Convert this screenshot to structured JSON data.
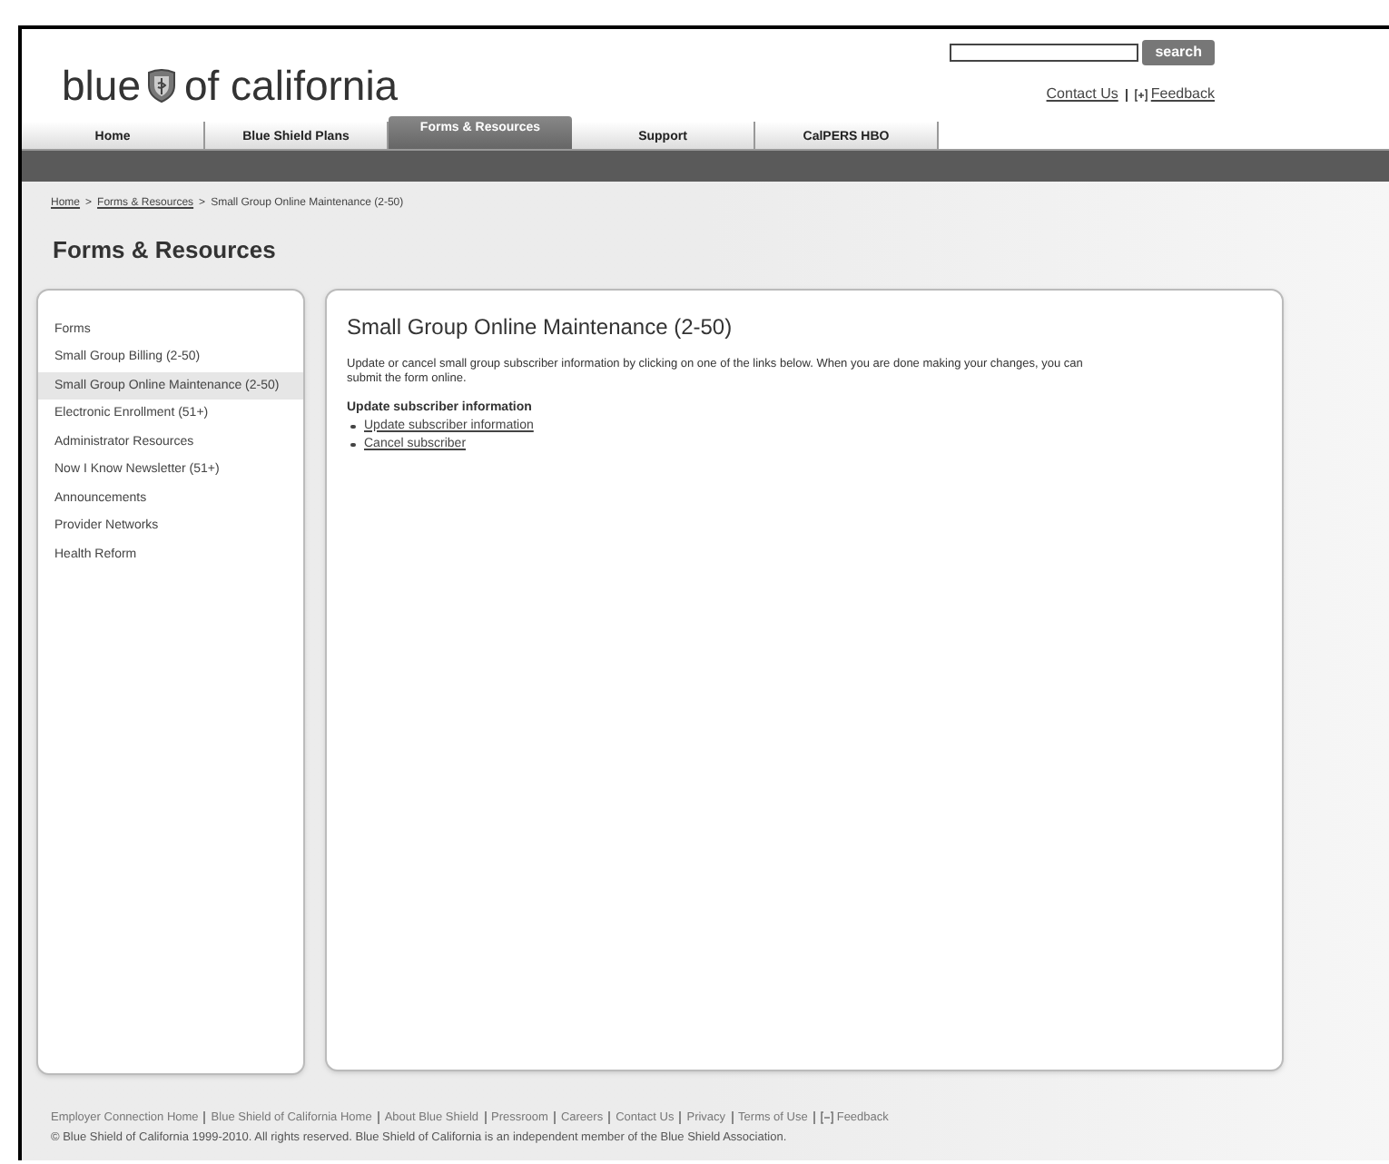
{
  "logo": {
    "before": "blue",
    "after": "of california"
  },
  "search": {
    "button": "search"
  },
  "header_links": [
    {
      "label": "Contact Us",
      "kind": "plain"
    },
    {
      "label": "Feedback",
      "kind": "plus"
    }
  ],
  "tabs": [
    {
      "label": "Home",
      "selected": false
    },
    {
      "label": "Blue Shield Plans",
      "selected": false
    },
    {
      "label": "Forms & Resources",
      "selected": true
    },
    {
      "label": "Support",
      "selected": false
    },
    {
      "label": "CalPERS HBO",
      "selected": false
    }
  ],
  "breadcrumb_separator": ">",
  "breadcrumb": [
    {
      "label": "Home",
      "link": true
    },
    {
      "label": "Forms & Resources",
      "link": true
    },
    {
      "label": "Small Group Online Maintenance (2-50)",
      "link": false
    }
  ],
  "page_title": "Forms & Resources",
  "sidebar": {
    "items": [
      {
        "label": "Forms",
        "selected": false
      },
      {
        "label": "Small Group Billing (2-50)",
        "selected": false
      },
      {
        "label": "Small Group Online Maintenance (2-50)",
        "selected": true
      },
      {
        "label": "Electronic Enrollment (51+)",
        "selected": false
      },
      {
        "label": "Administrator Resources",
        "selected": false
      },
      {
        "label": "Now I Know Newsletter (51+)",
        "selected": false
      },
      {
        "label": "Announcements",
        "selected": false
      },
      {
        "label": "Provider Networks",
        "selected": false
      },
      {
        "label": "Health Reform",
        "selected": false
      }
    ]
  },
  "main": {
    "heading": "Small Group Online Maintenance (2-50)",
    "intro": "Update or cancel small group subscriber information by clicking on one of the links below. When you are done making your changes, you can submit the form online.",
    "subheading": "Update subscriber information",
    "links": [
      "Update subscriber information",
      "Cancel subscriber"
    ]
  },
  "footer": {
    "links": [
      {
        "label": "Employer Connection Home",
        "kind": "plain"
      },
      {
        "label": "Blue Shield of California Home",
        "kind": "plain"
      },
      {
        "label": "About Blue Shield",
        "kind": "plain"
      },
      {
        "label": "Pressroom",
        "kind": "plain"
      },
      {
        "label": "Careers",
        "kind": "plain"
      },
      {
        "label": "Contact Us",
        "kind": "plain"
      },
      {
        "label": "Privacy",
        "kind": "plain"
      },
      {
        "label": "Terms of Use",
        "kind": "plain"
      },
      {
        "label": "Feedback",
        "kind": "minus"
      }
    ],
    "copyright": "© Blue Shield of California 1999-2010. All rights reserved. Blue Shield of California is an independent member of the Blue Shield Association."
  }
}
